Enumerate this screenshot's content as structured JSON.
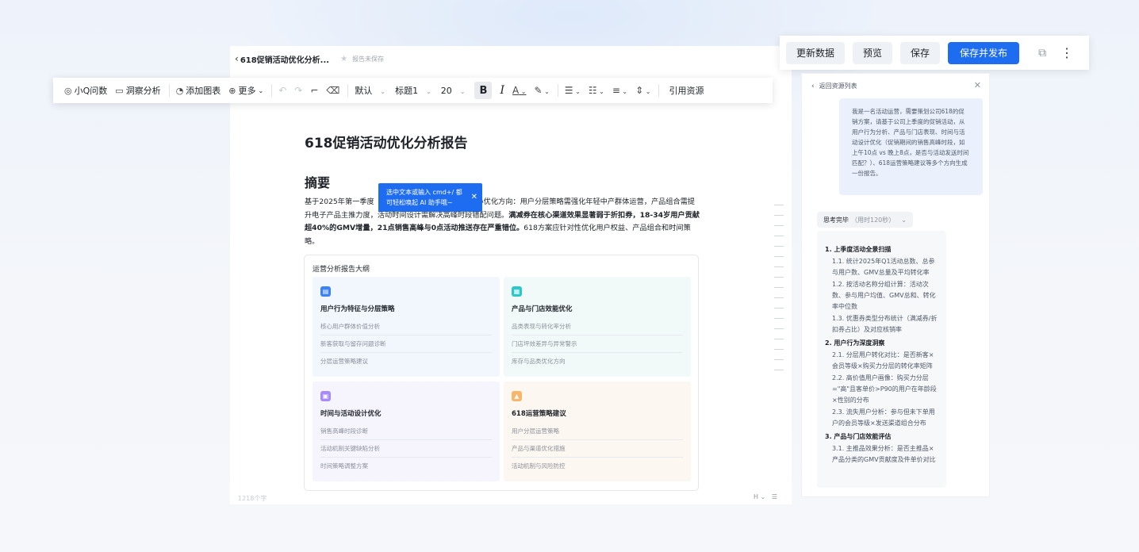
{
  "report_bar": {
    "name": "618促销活动优化分析...",
    "status": "报告未保存"
  },
  "toolbar": {
    "xiaoq": "小Q问数",
    "insight": "洞察分析",
    "add_chart": "添加图表",
    "more": "更多",
    "font": "默认",
    "heading": "标题1",
    "size": "20",
    "ref": "引用资源"
  },
  "actions": {
    "update": "更新数据",
    "preview": "预览",
    "save": "保存",
    "publish": "保存并发布"
  },
  "tooltip": {
    "line1": "选中文本或输入 cmd+/ 都",
    "line2": "可轻松唤起 AI 助手哦~"
  },
  "doc": {
    "title": "618促销活动优化分析报告",
    "section": "摘要",
    "p_start": "基于2025年第一季度",
    "p_mid": "出三个核心优化方向：用户分层策略需强化年轻中产群体运营，产品组合需提升电子产品主推力度，活动时间设计需解决高峰时段错配问题。",
    "p_bold": "满减券在核心渠道效果显著弱于折扣券，18-34岁用户贡献超40%的GMV增量，21点销售高峰与0点活动推送存在严重错位。",
    "p_end": "618方案应针对性优化用户权益、产品组合和时间策略。"
  },
  "outline": {
    "title": "运营分析报告大纲",
    "cells": [
      {
        "title": "用户行为特征与分层策略",
        "items": [
          "核心用户群体价值分析",
          "新客获取与留存问题诊断",
          "分层运营策略建议"
        ],
        "color": "#3b82f6"
      },
      {
        "title": "产品与门店效能优化",
        "items": [
          "品类表现与转化率分析",
          "门店坪效差异与异常警示",
          "库存与品类优化方向"
        ],
        "color": "#2ec7c9"
      },
      {
        "title": "时间与活动设计优化",
        "items": [
          "销售高峰时段诊断",
          "活动机制关键缺陷分析",
          "时间策略调整方案"
        ],
        "color": "#a78bfa"
      },
      {
        "title": "618运营策略建议",
        "items": [
          "用户分层运营策略",
          "产品与渠道优化措施",
          "活动机制与风险防控"
        ],
        "color": "#fbb56b"
      }
    ]
  },
  "status_bar": {
    "words": "1218个字"
  },
  "panel": {
    "back": "返回资源列表",
    "prompt": "我是一名活动运营，需要策划公司618的促销方案，请基于公司上季度的促销活动，从用户行为分析、产品与门店表现、时间与活动设计优化（促销期间的销售高峰时段，如上午10点 vs 晚上8点，是否与活动发送时间匹配？）、618运营策略建议等多个方向生成一份报告。",
    "think": "思考完毕",
    "think_time": "（用时120秒）",
    "plan": [
      {
        "title": "1. 上季度活动全景扫描",
        "subs": [
          "1.1. 统计2025年Q1活动总数、总参与用户数、GMV总量及平均转化率",
          "1.2. 按活动名称分组计算：活动次数、参与用户均值、GMV总和、转化率中位数",
          "1.3. 优惠券类型分布统计（满减券/折扣券占比）及对应核销率"
        ]
      },
      {
        "title": "2. 用户行为深度洞察",
        "subs": [
          "2.1. 分层用户转化对比：是否新客×会员等级×购买力分层的转化率矩阵",
          "2.2. 高价值用户画像：购买力分层=\"高\"且客单价>P90的用户在年龄段×性别的分布",
          "2.3. 流失用户分析：参与但未下单用户的会员等级×发送渠道组合分布"
        ]
      },
      {
        "title": "3. 产品与门店效能评估",
        "subs": [
          "3.1. 主推品效果分析：是否主推品×产品分类的GMV贡献度及件单价对比"
        ]
      }
    ]
  },
  "icons": [
    "chevron-left-icon",
    "star-icon",
    "chat-q-icon",
    "comment-icon",
    "pie-chart-icon",
    "plus-circle-icon",
    "undo-icon",
    "redo-icon",
    "format-painter-icon",
    "eraser-icon",
    "external-link-icon",
    "more-vertical-icon",
    "close-icon"
  ]
}
